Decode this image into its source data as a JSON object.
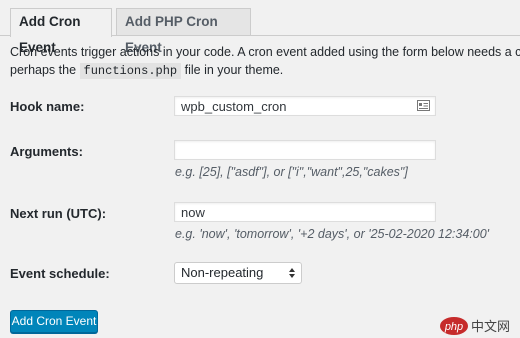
{
  "tabs": [
    {
      "label": "Add Cron Event"
    },
    {
      "label": "Add PHP Cron Event"
    }
  ],
  "description": {
    "line1": "Cron events trigger actions in your code. A cron event added using the form below needs a corresponding action",
    "line2_prefix": "perhaps the",
    "line2_code": "functions.php",
    "line2_suffix": "file in your theme."
  },
  "form": {
    "hook_name": {
      "label": "Hook name:",
      "value": "wpb_custom_cron"
    },
    "arguments": {
      "label": "Arguments:",
      "value": "",
      "hint": "e.g. [25], [\"asdf\"], or [\"i\",\"want\",25,\"cakes\"]"
    },
    "next_run": {
      "label": "Next run (UTC):",
      "value": "now",
      "hint": "e.g. 'now', 'tomorrow', '+2 days', or '25-02-2020 12:34:00'"
    },
    "schedule": {
      "label": "Event schedule:",
      "selected": "Non-repeating"
    },
    "submit_label": "Add Cron Event"
  },
  "watermark": {
    "text": "php 中文网"
  }
}
